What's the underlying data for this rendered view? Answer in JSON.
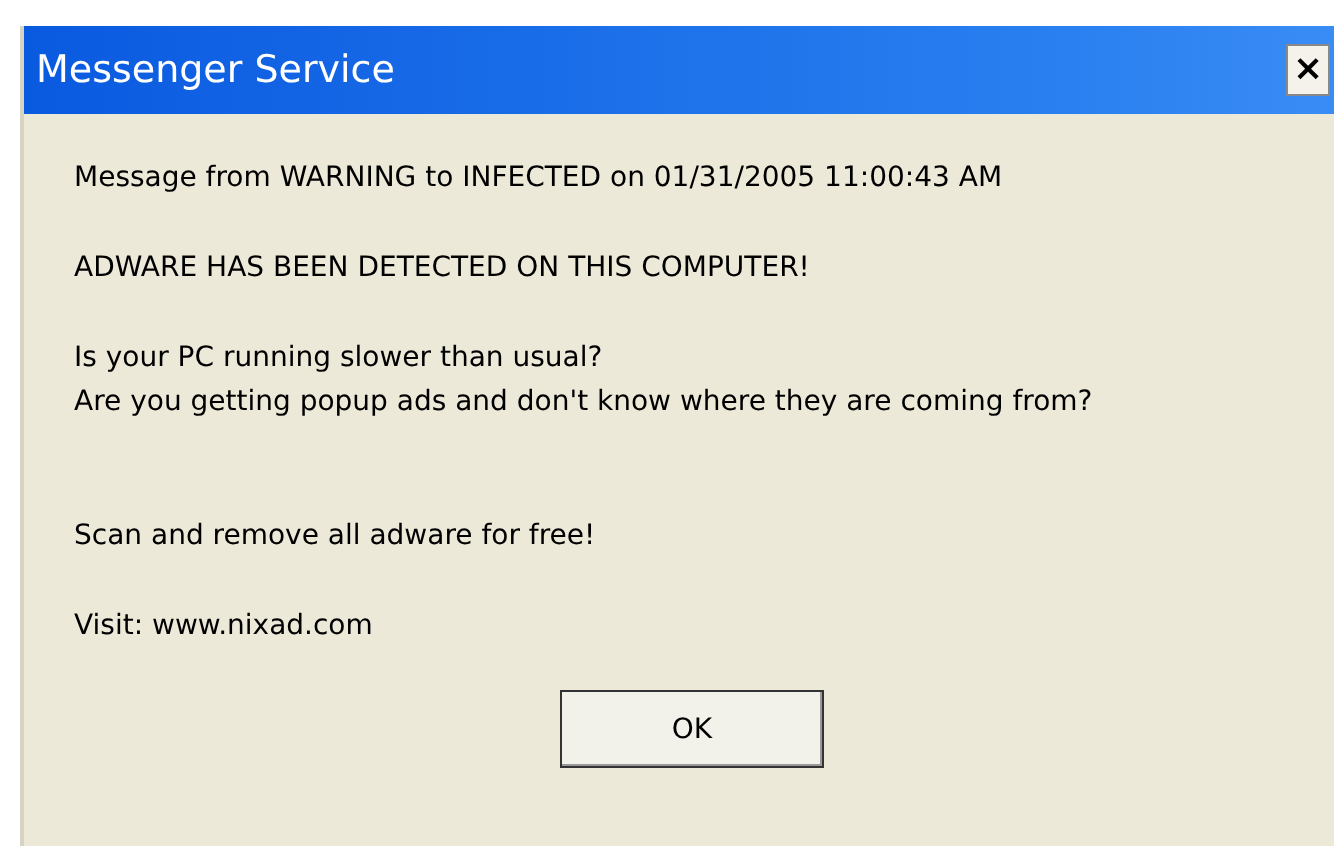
{
  "window": {
    "title": "Messenger Service",
    "close_glyph": "×"
  },
  "paragraphs": [
    [
      "Message from WARNING to INFECTED on 01/31/2005 11:00:43 AM"
    ],
    [
      "ADWARE HAS BEEN DETECTED ON THIS COMPUTER!"
    ],
    [
      "Is your PC running slower than usual?",
      "Are you getting popup ads and don't know where they are coming from?"
    ],
    [
      "Scan and remove all adware for free!"
    ],
    [
      "Visit: www.nixad.com"
    ]
  ],
  "buttons": [
    "OK"
  ]
}
